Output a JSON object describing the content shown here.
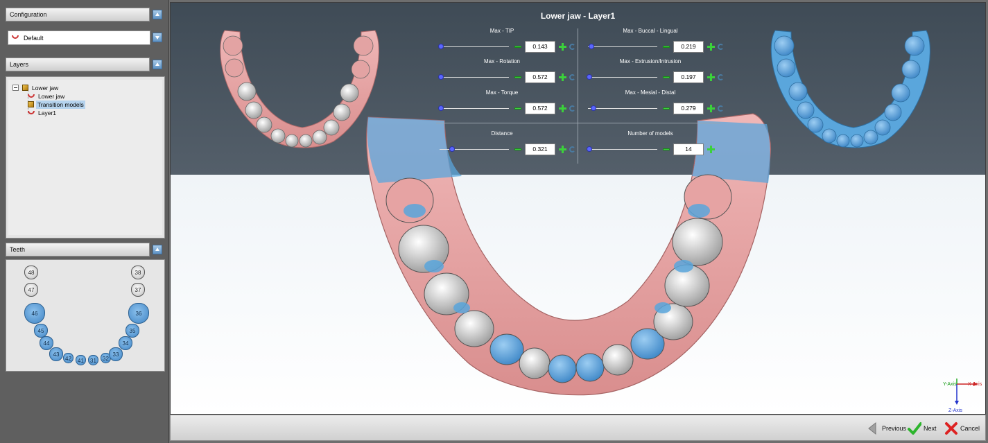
{
  "left_panel": {
    "configuration": {
      "header": "Configuration",
      "selected": "Default"
    },
    "layers": {
      "header": "Layers",
      "tree": [
        {
          "label": "Lower jaw",
          "level": 0,
          "icon": "box-icon"
        },
        {
          "label": "Lower jaw",
          "level": 1,
          "icon": "jaw-icon"
        },
        {
          "label": "Transition models",
          "level": 1,
          "icon": "box-icon",
          "selected": true
        },
        {
          "label": "Layer1",
          "level": 1,
          "icon": "jaw-icon"
        }
      ]
    },
    "teeth": {
      "header": "Teeth",
      "items": [
        {
          "num": "48",
          "state": "white"
        },
        {
          "num": "47",
          "state": "white"
        },
        {
          "num": "46",
          "state": "blue"
        },
        {
          "num": "45",
          "state": "blue"
        },
        {
          "num": "44",
          "state": "blue"
        },
        {
          "num": "43",
          "state": "blue"
        },
        {
          "num": "42",
          "state": "blue"
        },
        {
          "num": "41",
          "state": "blue"
        },
        {
          "num": "31",
          "state": "blue"
        },
        {
          "num": "32",
          "state": "blue"
        },
        {
          "num": "33",
          "state": "blue"
        },
        {
          "num": "34",
          "state": "blue"
        },
        {
          "num": "35",
          "state": "blue"
        },
        {
          "num": "36",
          "state": "blue"
        },
        {
          "num": "37",
          "state": "white"
        },
        {
          "num": "38",
          "state": "white"
        }
      ]
    }
  },
  "viewport": {
    "title": "Lower jaw - Layer1",
    "controls": [
      {
        "label": "Max - TIP",
        "value": "0.143",
        "level": 0.02
      },
      {
        "label": "Max - Buccal - Lingual",
        "value": "0.219",
        "level": 0.05
      },
      {
        "label": "Max - Rotation",
        "value": "0.572",
        "level": 0.02
      },
      {
        "label": "Max - Extrusion/Intrusion",
        "value": "0.197",
        "level": 0.02
      },
      {
        "label": "Max - Torque",
        "value": "0.572",
        "level": 0.02
      },
      {
        "label": "Max - Mesial - Distal",
        "value": "0.279",
        "level": 0.08
      },
      {
        "label": "Distance",
        "value": "0.321",
        "level": 0.18
      },
      {
        "label": "Number of models",
        "value": "14",
        "level": 0.02
      }
    ],
    "axis": {
      "y": "Y-Axis",
      "x": "X-Axis",
      "z": "Z-Axis"
    },
    "colors": {
      "gum_pink": "#e6a3a3",
      "aligner_blue": "#5aa6dc",
      "tooth_white": "#e9e9e9"
    }
  },
  "bottom_bar": {
    "previous": "Previous",
    "next": "Next",
    "cancel": "Cancel"
  }
}
